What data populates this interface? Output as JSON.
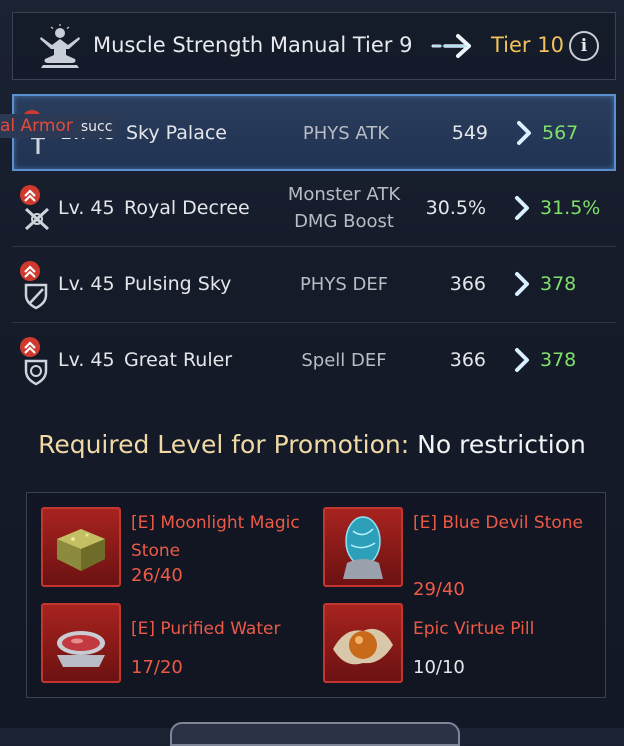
{
  "header": {
    "title": "Muscle Strength Manual Tier 9",
    "next_tier": "Tier 10",
    "info_label": "i"
  },
  "overlay": {
    "text": "al Armor",
    "suffix": "succ"
  },
  "stats": [
    {
      "level": "Lv. 45",
      "name": "Sky Palace",
      "stat": "PHYS ATK",
      "stat_line2": "",
      "from": "549",
      "to": "567",
      "icon": "sword-icon"
    },
    {
      "level": "Lv. 45",
      "name": "Royal Decree",
      "stat": "Monster ATK",
      "stat_line2": "DMG Boost",
      "from": "30.5%",
      "to": "31.5%",
      "icon": "crossed-swords-icon"
    },
    {
      "level": "Lv. 45",
      "name": "Pulsing Sky",
      "stat": "PHYS DEF",
      "stat_line2": "",
      "from": "366",
      "to": "378",
      "icon": "shield-sword-icon"
    },
    {
      "level": "Lv. 45",
      "name": "Great Ruler",
      "stat": "Spell DEF",
      "stat_line2": "",
      "from": "366",
      "to": "378",
      "icon": "spell-shield-icon"
    }
  ],
  "promotion": {
    "label": "Required Level for Promotion:",
    "value": "No restriction"
  },
  "materials": [
    {
      "name": "[E] Moonlight Magic Stone",
      "count": "26/40",
      "icon": "moonlight-stone-icon"
    },
    {
      "name": "[E] Blue Devil Stone",
      "count": "29/40",
      "icon": "blue-devil-stone-icon"
    },
    {
      "name": "[E] Purified Water",
      "count": "17/20",
      "icon": "purified-water-icon"
    },
    {
      "name": "Epic Virtue Pill",
      "count": "10/10",
      "icon": "virtue-pill-icon"
    }
  ],
  "colors": {
    "accent_gold": "#f1c15c",
    "increase_green": "#7fe06a",
    "insufficient_red": "#ec5a46",
    "selected_border": "#5a8fd0"
  }
}
